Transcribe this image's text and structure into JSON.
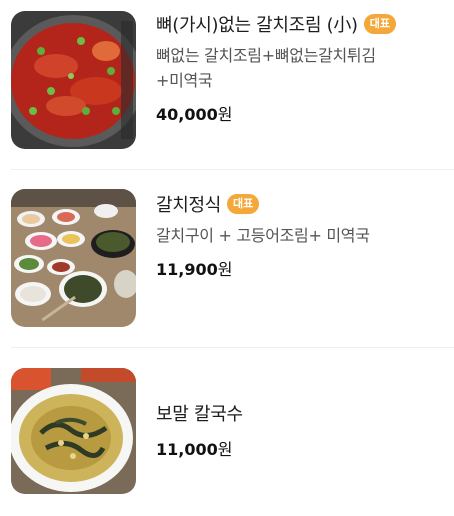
{
  "menu": {
    "items": [
      {
        "name": "뼈(가시)없는 갈치조림 (小)",
        "badge": "대표",
        "desc_line1": "뼈없는 갈치조림+뼈없는갈치튀김",
        "desc_line2": "+미역국",
        "price": "40,000",
        "currency": "원",
        "image_icon": "braised-cutlassfish-photo"
      },
      {
        "name": "갈치정식",
        "badge": "대표",
        "desc_line1": "갈치구이 + 고등어조림+ 미역국",
        "price": "11,900",
        "currency": "원",
        "image_icon": "cutlassfish-set-meal-photo"
      },
      {
        "name": "보말 칼국수",
        "price": "11,000",
        "currency": "원",
        "image_icon": "seasnail-noodle-soup-photo"
      }
    ]
  },
  "colors": {
    "badge": "#f4a83a",
    "name": "#1e1e1e",
    "desc": "#555555",
    "divider": "#eeeeee"
  }
}
